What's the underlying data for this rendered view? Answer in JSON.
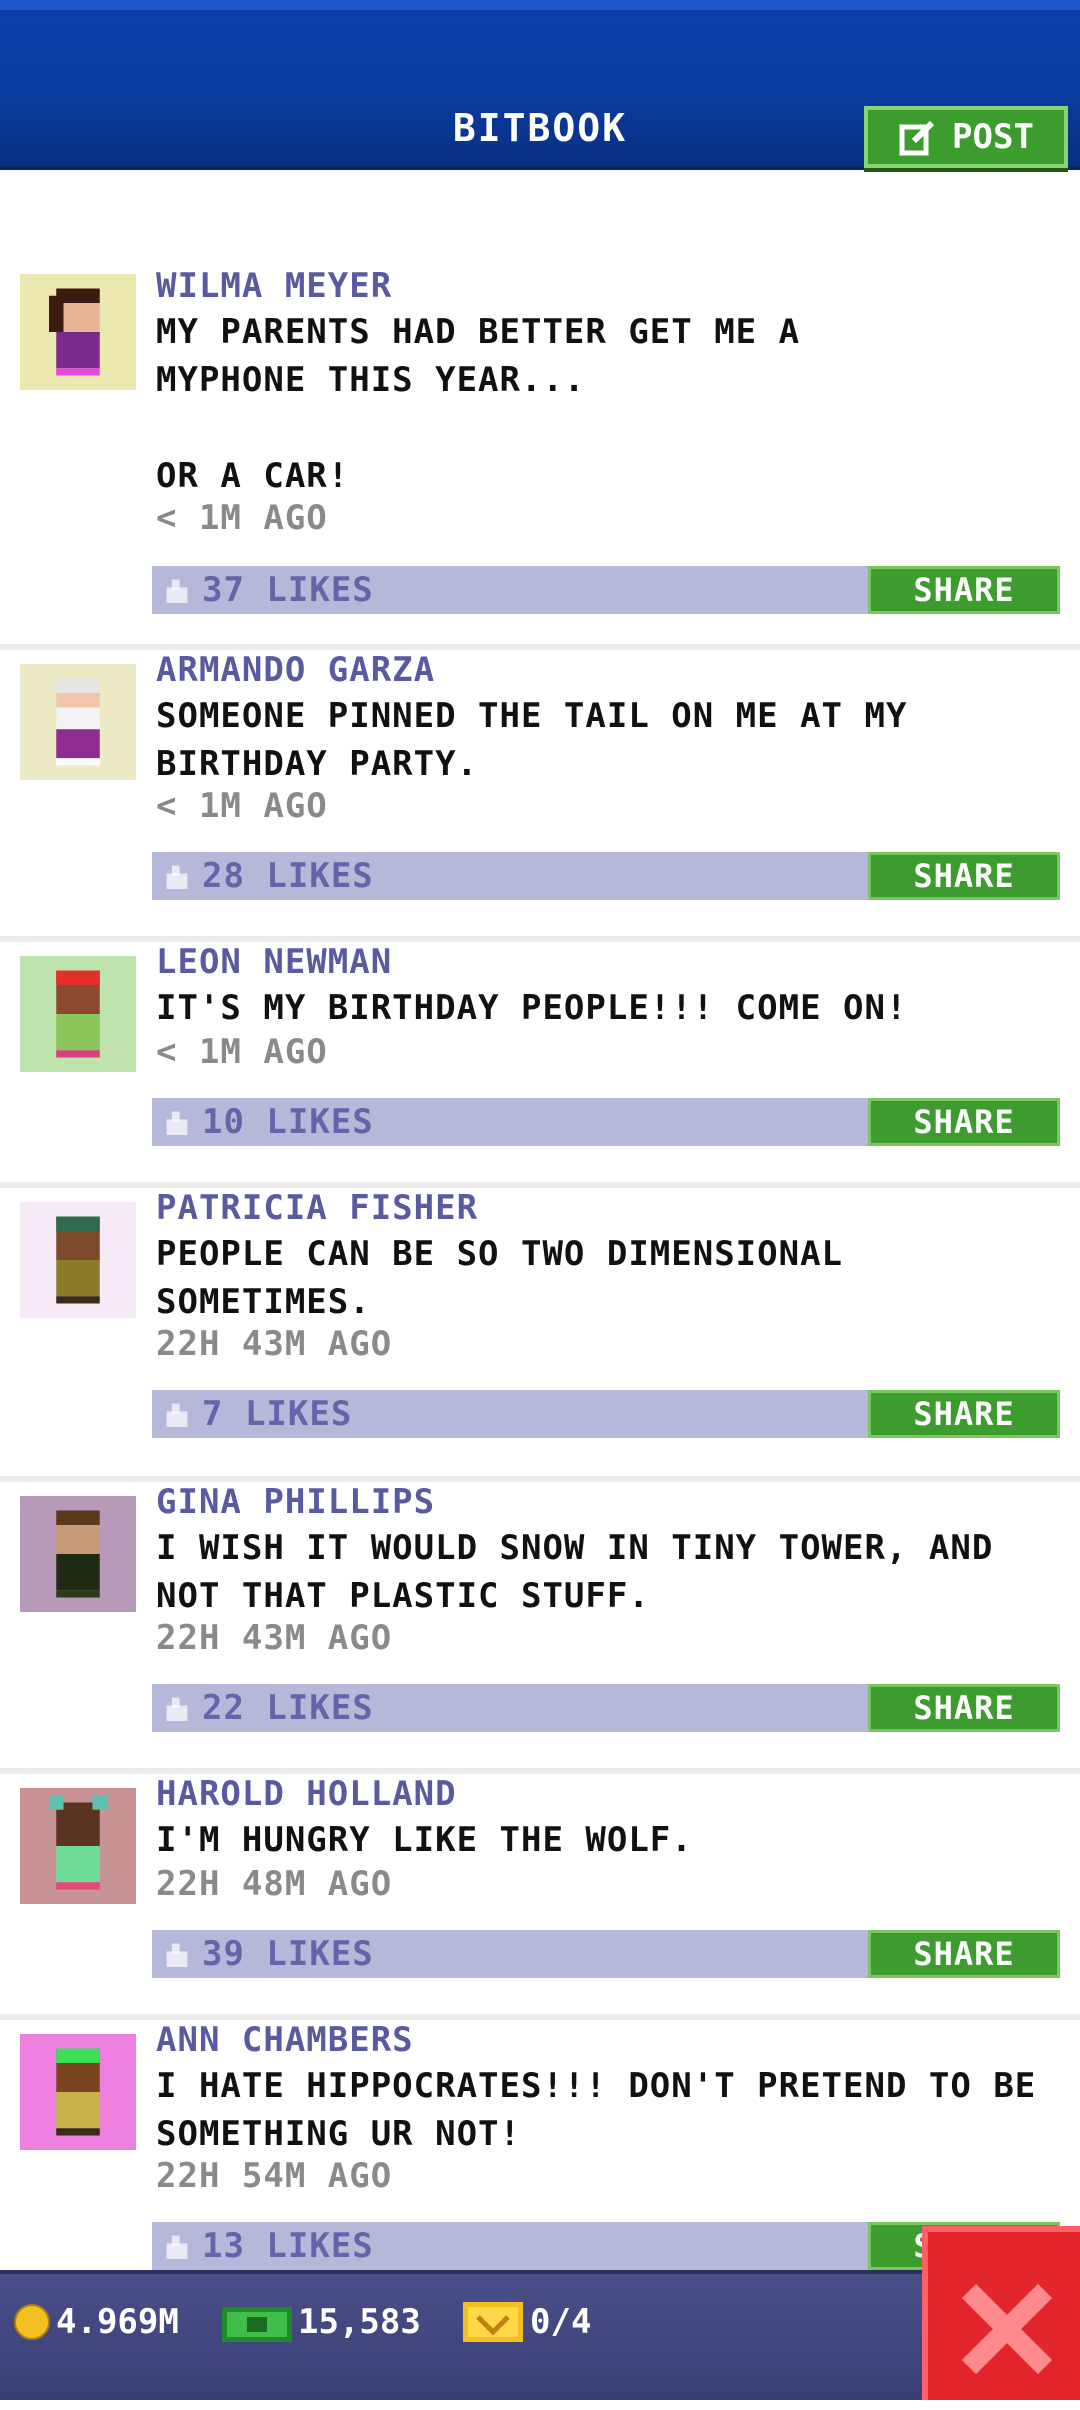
{
  "header": {
    "title": "BITBOOK",
    "post_label": "POST"
  },
  "posts": [
    {
      "name": "WILMA MEYER",
      "text": "MY PARENTS HAD BETTER GET ME A\nMYPHONE THIS YEAR...\n\nOR A CAR!",
      "time": "< 1M AGO",
      "likes": "37 LIKES",
      "share": "SHARE"
    },
    {
      "name": "ARMANDO GARZA",
      "text": "SOMEONE PINNED THE TAIL ON ME AT MY\nBIRTHDAY PARTY.",
      "time": "< 1M AGO",
      "likes": "28 LIKES",
      "share": "SHARE"
    },
    {
      "name": "LEON NEWMAN",
      "text": "IT'S MY BIRTHDAY PEOPLE!!! COME ON!",
      "time": "< 1M AGO",
      "likes": "10 LIKES",
      "share": "SHARE"
    },
    {
      "name": "PATRICIA FISHER",
      "text": "PEOPLE CAN BE SO TWO DIMENSIONAL\nSOMETIMES.",
      "time": "22H 43M AGO",
      "likes": "7 LIKES",
      "share": "SHARE"
    },
    {
      "name": "GINA PHILLIPS",
      "text": "I WISH IT WOULD SNOW IN TINY TOWER, AND\nNOT THAT PLASTIC STUFF.",
      "time": "22H 43M AGO",
      "likes": "22 LIKES",
      "share": "SHARE"
    },
    {
      "name": "HAROLD HOLLAND",
      "text": "I'M HUNGRY LIKE THE WOLF.",
      "time": "22H 48M AGO",
      "likes": "39 LIKES",
      "share": "SHARE"
    },
    {
      "name": "ANN CHAMBERS",
      "text": "I HATE HIPPOCRATES!!! DON'T PRETEND TO BE\nSOMETHING UR NOT!",
      "time": "22H 54M AGO",
      "likes": "13 LIKES",
      "share": "SHARE"
    }
  ],
  "footer": {
    "coins": "4.969M",
    "bux": "15,583",
    "tickets": "0/4"
  },
  "colors": {
    "header": "#0b3fa8",
    "accent_green": "#3c9d2e",
    "likes_bar": "#b6b8da",
    "close": "#e3262c"
  }
}
